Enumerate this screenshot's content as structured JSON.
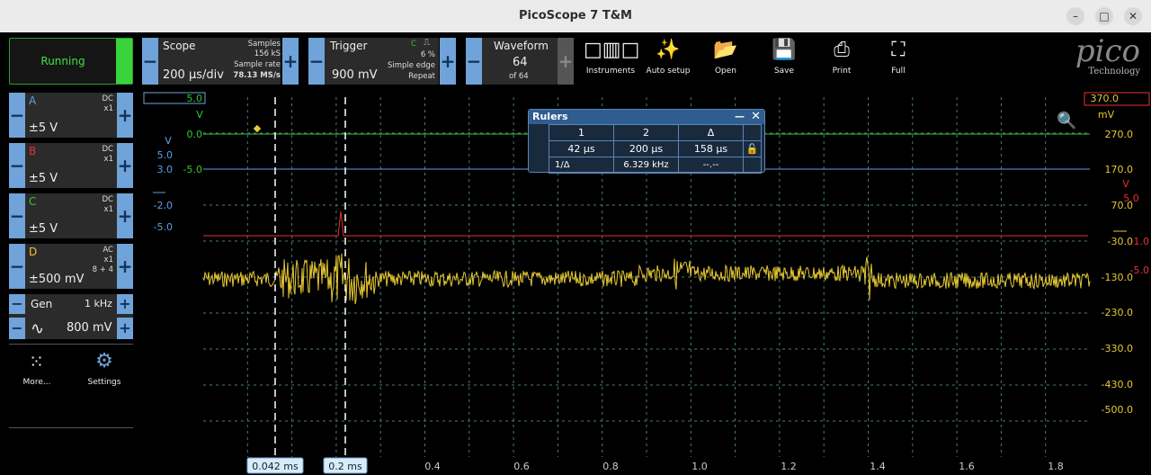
{
  "window": {
    "title": "PicoScope 7 T&M",
    "minimize": "–",
    "maximize": "□",
    "close": "✕"
  },
  "status": {
    "label": "Running"
  },
  "scope_ctl": {
    "title": "Scope",
    "timebase": "200 µs/div",
    "samples_label": "Samples",
    "samples": "156 kS",
    "rate_label": "Sample rate",
    "rate": "78.13 MS/s"
  },
  "trigger_ctl": {
    "title": "Trigger",
    "level": "900 mV",
    "channel": "C",
    "percent": "6 %",
    "type": "Simple edge",
    "mode": "Repeat"
  },
  "waveform_ctl": {
    "title": "Waveform",
    "current": "64",
    "total": "of 64"
  },
  "tools": {
    "instruments": "Instruments",
    "auto_setup": "Auto setup",
    "open": "Open",
    "save": "Save",
    "print": "Print",
    "full": "Full"
  },
  "brand": {
    "logo": "pico",
    "sub": "Technology"
  },
  "channels": [
    {
      "name": "A",
      "coupling": "DC",
      "probe": "x1",
      "extra": "",
      "range": "±5 V",
      "color": "#5aa0e6"
    },
    {
      "name": "B",
      "coupling": "DC",
      "probe": "x1",
      "extra": "",
      "range": "±5 V",
      "color": "#e63232"
    },
    {
      "name": "C",
      "coupling": "DC",
      "probe": "x1",
      "extra": "",
      "range": "±5 V",
      "color": "#32c832"
    },
    {
      "name": "D",
      "coupling": "AC",
      "probe": "x1",
      "extra": "8 + 4",
      "range": "±500 mV",
      "color": "#e6c832"
    }
  ],
  "gen": {
    "label": "Gen",
    "freq": "1 kHz",
    "amp": "800 mV"
  },
  "bottom": {
    "more": "More...",
    "settings": "Settings"
  },
  "rulers": {
    "title": "Rulers",
    "col1": "1",
    "col2": "2",
    "col3": "Δ",
    "r1": "42 µs",
    "r2": "200 µs",
    "rd": "158 µs",
    "inv_label": "1/Δ",
    "inv_val": "6.329 kHz",
    "inv_d": "--.--"
  },
  "axes": {
    "left_green_unit": "V",
    "left_green": [
      "5.0",
      "0.0",
      "-5.0"
    ],
    "left_blue_unit": "V",
    "left_blue": [
      "5.0",
      "3.0",
      "-2.0",
      "-5.0"
    ],
    "right_yellow_unit": "mV",
    "right_yellow": [
      "370.0",
      "270.0",
      "170.0",
      "70.0",
      "-30.0",
      "-130.0",
      "-230.0",
      "-330.0",
      "-430.0",
      "-500.0"
    ],
    "right_red_unit": "V",
    "right_red": [
      "5.0",
      "-1.0",
      "-5.0"
    ],
    "x_ticks": [
      "0.4",
      "0.6",
      "0.8",
      "1.0",
      "1.2",
      "1.4",
      "1.6",
      "1.8"
    ],
    "cursor1": "0.042 ms",
    "cursor2": "0.2 ms"
  },
  "colors": {
    "panel": "#2b2b2b",
    "accent": "#6fa3d9",
    "trace_d": "#e6c832",
    "trace_b": "#e63232",
    "trace_c": "#32c832",
    "trace_a": "#5aa0e6"
  }
}
